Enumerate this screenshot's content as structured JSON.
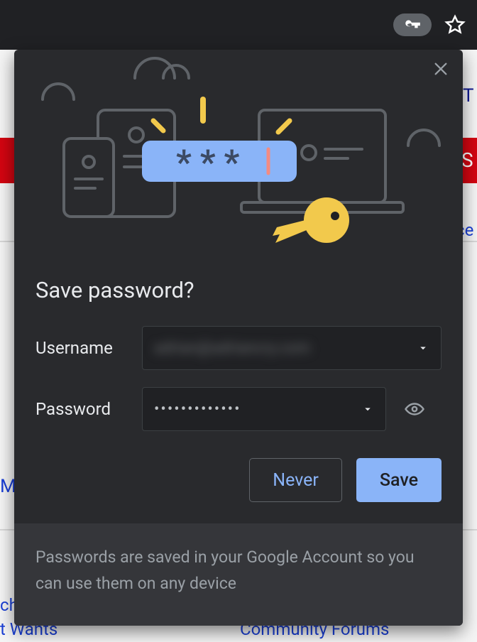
{
  "dialog": {
    "title": "Save password?",
    "username_label": "Username",
    "password_label": "Password",
    "username_value": "adrian@adriancry.com",
    "password_masked": "•••••••••••••",
    "never_label": "Never",
    "save_label": "Save",
    "footer_text": "Passwords are saved in your Google Account so you can use them on any device"
  },
  "background": {
    "bottom_left": "t Wants",
    "bottom_right": "Community Forums",
    "left_m": "M",
    "left_ch": "ch",
    "right_ce": "ce",
    "right_s": "S",
    "right_t": "T"
  }
}
